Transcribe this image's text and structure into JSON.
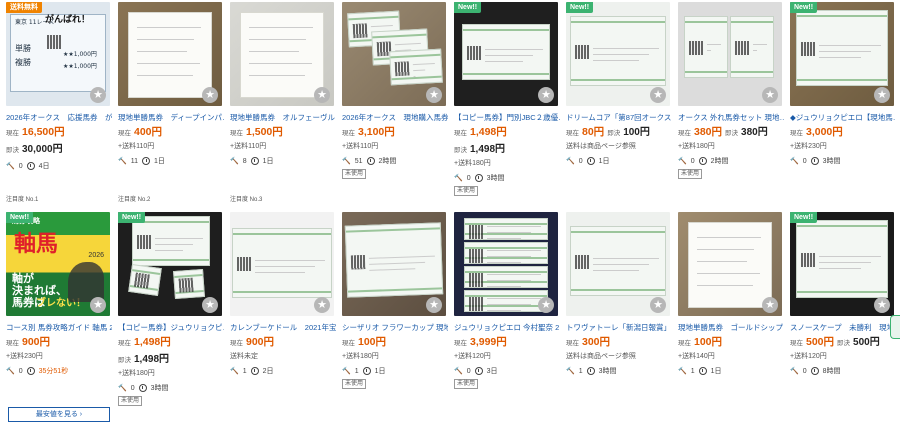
{
  "labels": {
    "current": "現在",
    "buy_now": "即決",
    "unused": "未使用",
    "more_button": "最安値を見る ›",
    "star": "★"
  },
  "row1": [
    {
      "tag": "送料無料",
      "tag_color": "orange",
      "title": "2026年オークス　応援馬券　が…",
      "price": "16,500円",
      "bid_label": "即決",
      "bid": "30,000円",
      "ship": "",
      "watch": "0",
      "time": "4日",
      "attention": "注目度 No.1",
      "unused": false
    },
    {
      "tag": "",
      "title": "現地単勝馬券　ディープインパ…",
      "price": "400円",
      "bid": "",
      "ship": "+送料110円",
      "watch": "11",
      "time": "1日",
      "attention": "注目度 No.2",
      "unused": false
    },
    {
      "tag": "",
      "title": "現地単勝馬券　オルフェーヴル…",
      "price": "1,500円",
      "bid": "",
      "ship": "+送料110円",
      "watch": "8",
      "time": "1日",
      "attention": "注目度 No.3",
      "unused": false
    },
    {
      "tag": "",
      "title": "2026年オークス　現地購入馬券…",
      "price": "3,100円",
      "bid": "",
      "ship": "+送料110円",
      "watch": "51",
      "time": "2時間",
      "attention": "",
      "unused": true
    },
    {
      "tag": "New!!",
      "title": "【コピー馬券】門別JBC２歳優…",
      "price": "1,498円",
      "bid_label": "即決",
      "bid": "1,498円",
      "ship": "+送料180円",
      "watch": "0",
      "time": "3時間",
      "attention": "",
      "unused": true
    },
    {
      "tag": "New!!",
      "title": "ドリームコア「第87回オークス…",
      "price": "80円",
      "bid_label": "即決",
      "bid": "100円",
      "ship": "送料は商品ページ参照",
      "watch": "0",
      "time": "1日",
      "attention": "",
      "unused": false
    },
    {
      "tag": "",
      "title": "オークス 外れ馬券セット 現地…",
      "price": "380円",
      "bid_label": "即決",
      "bid": "380円",
      "ship": "+送料180円",
      "watch": "0",
      "time": "2時間",
      "attention": "",
      "unused": true
    },
    {
      "tag": "New!!",
      "title": "◆ジュウリョクピエロ【現地馬…",
      "price": "3,000円",
      "bid": "",
      "ship": "+送料230円",
      "watch": "0",
      "time": "3時間",
      "attention": "",
      "unused": false
    }
  ],
  "row2": [
    {
      "tag": "New!!",
      "title": "コース別 馬券攻略ガイド 軸馬 2…",
      "price": "900円",
      "bid": "",
      "ship": "+送料230円",
      "watch": "0",
      "time": "35分51秒",
      "urgent": true,
      "unused": false
    },
    {
      "tag": "New!!",
      "title": "【コピー馬券】ジュウリョクピ…",
      "price": "1,498円",
      "bid_label": "即決",
      "bid": "1,498円",
      "ship": "+送料180円",
      "watch": "0",
      "time": "3時間",
      "unused": true
    },
    {
      "tag": "",
      "title": "カレンブーケドール　2021年宝…",
      "price": "900円",
      "bid": "",
      "ship": "送料未定",
      "watch": "1",
      "time": "2日",
      "unused": false
    },
    {
      "tag": "",
      "title": "シーザリオ フラワーカップ 現地…",
      "price": "100円",
      "bid": "",
      "ship": "+送料180円",
      "watch": "1",
      "time": "1日",
      "unused": true
    },
    {
      "tag": "",
      "title": "ジュウリョクピエロ 今村聖奈 2…",
      "price": "3,999円",
      "bid": "",
      "ship": "+送料120円",
      "watch": "0",
      "time": "3日",
      "unused": true
    },
    {
      "tag": "",
      "title": "トワヴァトーレ「新潟日報賞」…",
      "price": "300円",
      "bid": "",
      "ship": "送料は商品ページ参照",
      "watch": "1",
      "time": "3時間",
      "unused": false
    },
    {
      "tag": "",
      "title": "現地単勝馬券　ゴールドシップ…",
      "price": "100円",
      "bid": "",
      "ship": "+送料140円",
      "watch": "1",
      "time": "1日",
      "unused": false
    },
    {
      "tag": "New!!",
      "title": "スノースケープ　未勝利　現地…",
      "price": "500円",
      "bid_label": "即決",
      "bid": "500円",
      "ship": "+送料120円",
      "watch": "0",
      "time": "8時間",
      "unused": false
    }
  ],
  "thumb_text": {
    "t1_big": "がんばれ！",
    "t1_race": "東京 11レース",
    "t1_a": "単勝",
    "t1_b": "複勝",
    "t1_amt": "★★1,000円",
    "t4_horse": "ジュウリョクピエロ"
  },
  "book": {
    "top": "馬券攻略",
    "title": "軸馬",
    "year": "2026",
    "line1": "軸が",
    "line2": "決まれば、",
    "line3": "馬券は",
    "line4": "ブレない！"
  },
  "colors": {
    "link": "#1a5aa8",
    "price": "#e05a00",
    "new_tag": "#3cb371",
    "free_ship_tag": "#f08300"
  }
}
